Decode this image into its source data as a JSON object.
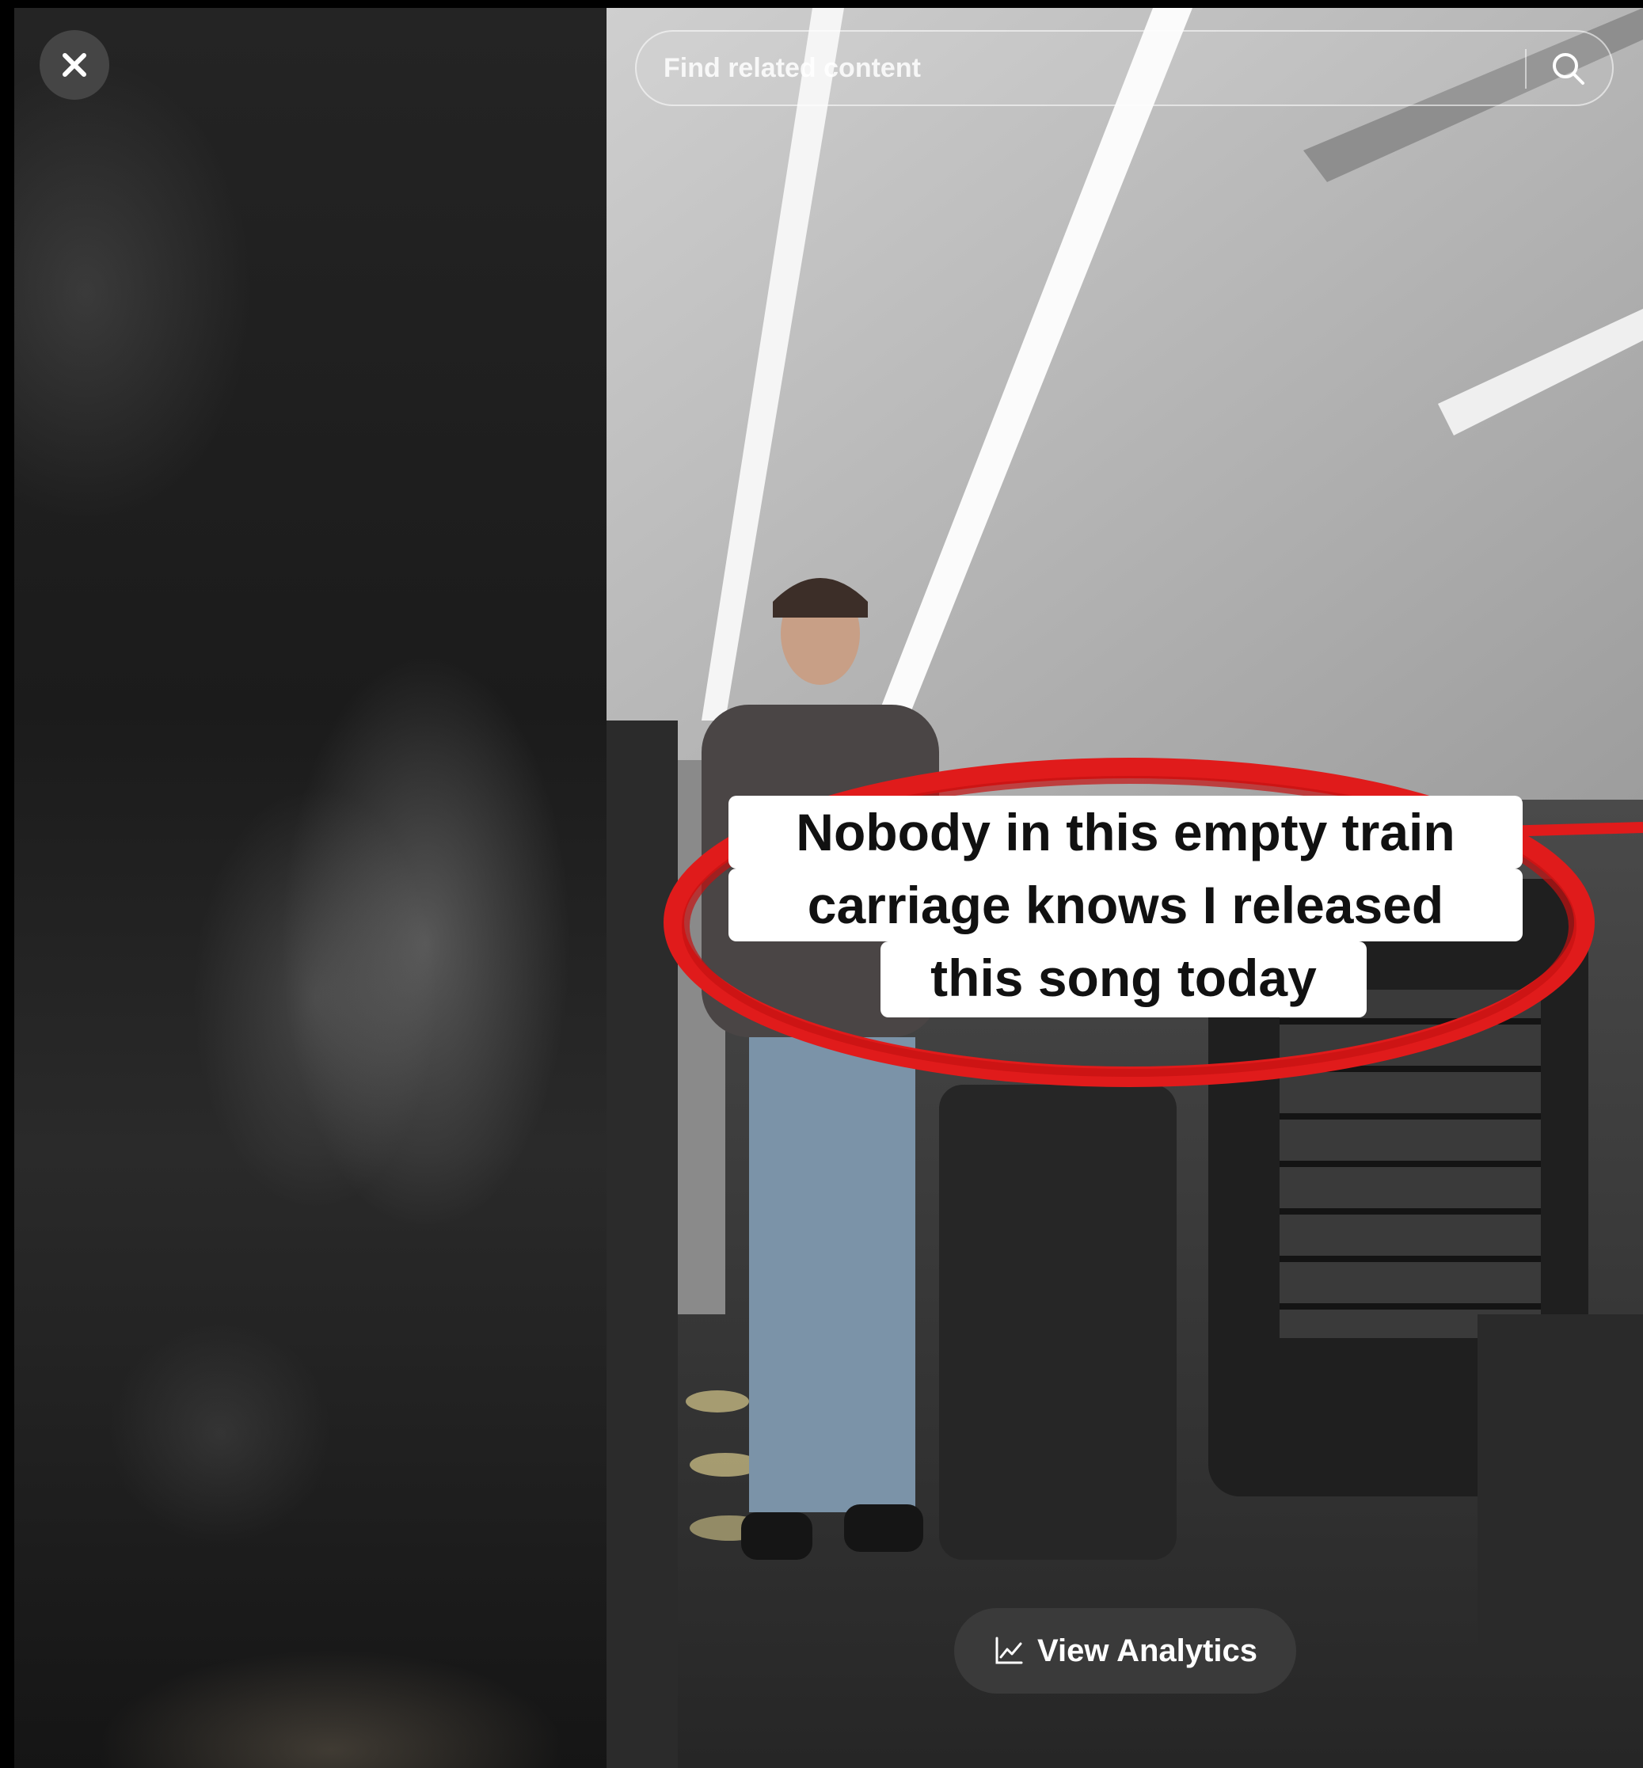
{
  "close_button": {
    "icon": "close-icon"
  },
  "search": {
    "placeholder": "Find related content",
    "icon": "search-icon"
  },
  "video": {
    "caption_lines": [
      "Nobody in this empty train",
      "carriage knows I released",
      "this song today"
    ],
    "highlight_color": "#e01b1b"
  },
  "analytics": {
    "label": "View Analytics",
    "icon": "line-chart-icon"
  }
}
